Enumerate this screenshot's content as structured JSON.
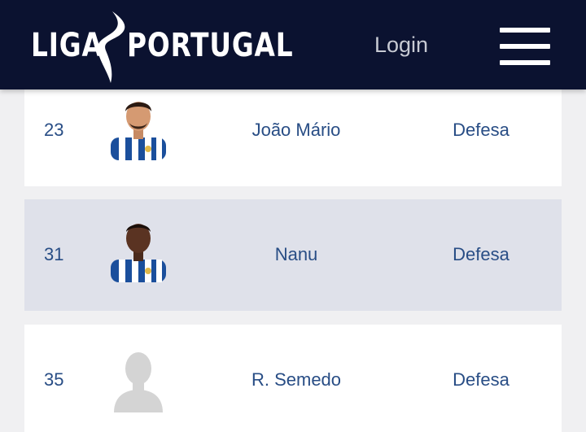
{
  "header": {
    "logo_left": "LIGA",
    "logo_right": "PORTUGAL",
    "login_label": "Login",
    "menu_icon": "hamburger-menu-icon",
    "background_color": "#0b1230"
  },
  "squad": {
    "rows": [
      {
        "number": "23",
        "name": "João Mário",
        "position": "Defesa",
        "photo": "player-photo-icon",
        "highlighted": false
      },
      {
        "number": "31",
        "name": "Nanu",
        "position": "Defesa",
        "photo": "player-photo-icon",
        "highlighted": true
      },
      {
        "number": "35",
        "name": "R. Semedo",
        "position": "Defesa",
        "photo": "avatar-placeholder-icon",
        "highlighted": false
      }
    ]
  },
  "colors": {
    "text": "#284d85",
    "row_bg": "#ffffff",
    "row_highlight_bg": "#dfe1ea",
    "page_bg": "#f0f0f2"
  }
}
